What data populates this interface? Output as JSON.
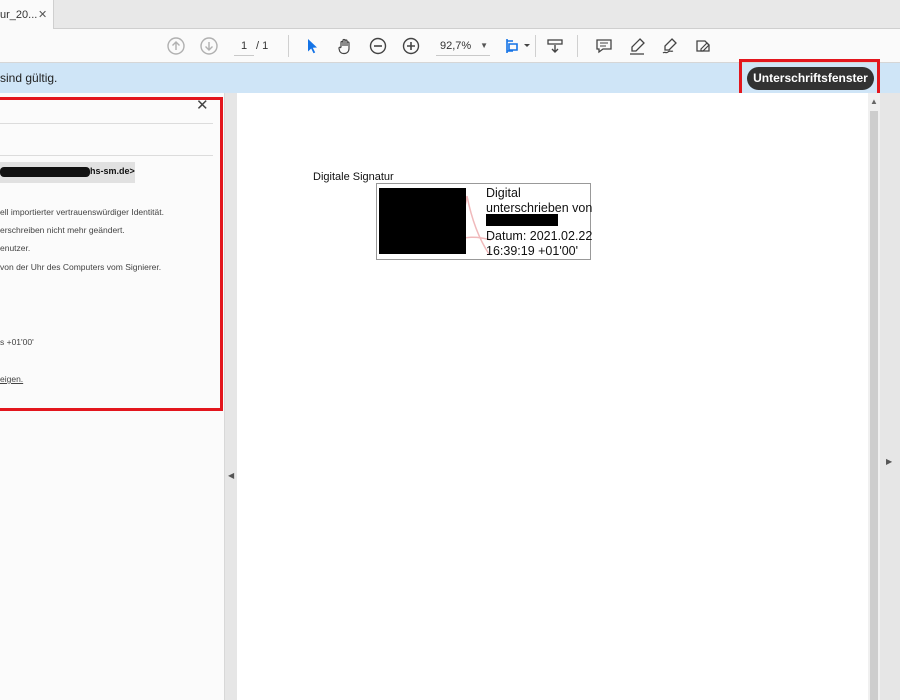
{
  "tab": {
    "title": "ur_20...",
    "close": "✕"
  },
  "toolbar": {
    "page_current": "1",
    "page_total": "/ 1",
    "zoom": "92,7%",
    "zoom_caret": "▼"
  },
  "notice": {
    "text": "sind gültig.",
    "button_label": "Unterschriftsfenster"
  },
  "panel": {
    "close": "✕",
    "email_suffix": "hs-sm.de>",
    "lines": [
      "ell importierter vertrauenswürdiger Identität.",
      "erschreiben nicht mehr geändert.",
      "enutzer.",
      "von der Uhr des Computers vom Signierer.",
      "s +01'00'",
      "eigen."
    ]
  },
  "document": {
    "label": "Digitale Signatur",
    "signature": {
      "line1": "Digital",
      "line2": "unterschrieben von",
      "date1": "Datum: 2021.02.22",
      "date2": "16:39:19 +01'00'"
    }
  },
  "scroll": {
    "up": "▲",
    "left": "◀",
    "right": "▶"
  },
  "colors": {
    "highlight": "#e3161d",
    "notice_bg": "#cfe5f7",
    "accent_blue": "#1473e6",
    "button_bg": "#323232"
  }
}
